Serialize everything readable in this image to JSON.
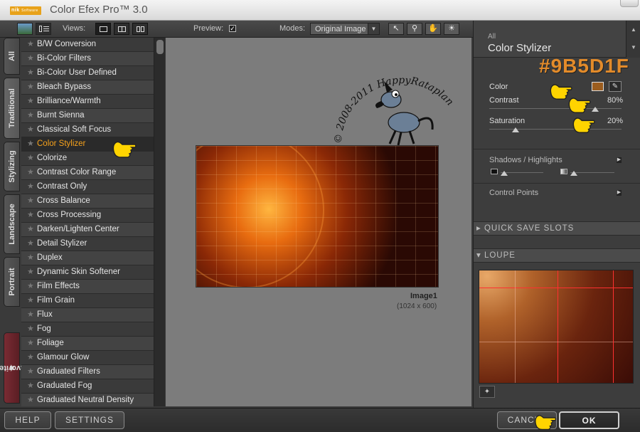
{
  "window": {
    "logo_text": "nik",
    "logo_subtext": "Software",
    "title": "Color Efex Pro™ 3.0"
  },
  "toolbar": {
    "views_label": "Views:",
    "preview_label": "Preview:",
    "preview_checked": true,
    "modes_label": "Modes:",
    "modes_value": "Original Image"
  },
  "side_tabs": [
    "All",
    "Traditional",
    "Stylizing",
    "Landscape",
    "Portrait",
    "Favorites"
  ],
  "filters": [
    "B/W Conversion",
    "Bi-Color Filters",
    "Bi-Color User Defined",
    "Bleach Bypass",
    "Brilliance/Warmth",
    "Burnt Sienna",
    "Classical Soft Focus",
    "Color Stylizer",
    "Colorize",
    "Contrast Color Range",
    "Contrast Only",
    "Cross Balance",
    "Cross Processing",
    "Darken/Lighten Center",
    "Detail Stylizer",
    "Duplex",
    "Dynamic Skin Softener",
    "Film Effects",
    "Film Grain",
    "Flux",
    "Fog",
    "Foliage",
    "Glamour Glow",
    "Graduated Filters",
    "Graduated Fog",
    "Graduated Neutral Density"
  ],
  "active_filter": "Color Stylizer",
  "preview": {
    "image_name": "Image1",
    "image_dims": "(1024 x 600)",
    "watermark_text_1": "© 2008-2011",
    "watermark_text_2": "HappyRataplan"
  },
  "panel": {
    "category": "All",
    "title": "Color Stylizer",
    "hex_annotation": "#9B5D1F",
    "color_label": "Color",
    "color_value": "#9B5D1F",
    "contrast_label": "Contrast",
    "contrast_value": "80%",
    "contrast_level": 0.8,
    "saturation_label": "Saturation",
    "saturation_value": "20%",
    "saturation_level": 0.2,
    "shadows_label": "Shadows / Highlights",
    "control_points_label": "Control Points",
    "quick_save_label": "QUICK SAVE SLOTS",
    "loupe_label": "LOUPE"
  },
  "buttons": {
    "help": "HELP",
    "settings": "SETTINGS",
    "cancel": "CANCEL",
    "ok": "OK"
  },
  "colors": {
    "accent": "#f6a21c",
    "hand_yellow": "#ffd400"
  }
}
